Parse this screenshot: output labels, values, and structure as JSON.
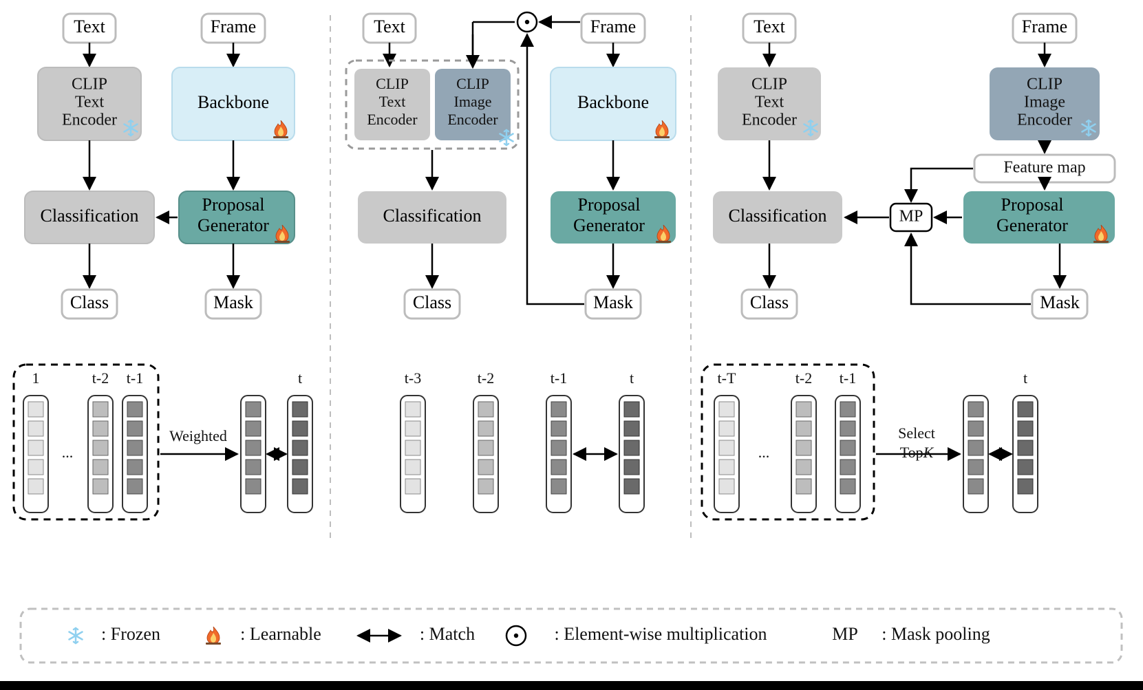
{
  "labels": {
    "text": "Text",
    "frame": "Frame",
    "clipText1": "CLIP",
    "clipText2": "Text",
    "clipText3": "Encoder",
    "clipImg1": "CLIP",
    "clipImg2": "Image",
    "clipImg3": "Encoder",
    "backbone": "Backbone",
    "classification": "Classification",
    "proposal1": "Proposal",
    "proposal2": "Generator",
    "class": "Class",
    "mask": "Mask",
    "featureMap": "Feature map",
    "mp": "MP",
    "weighted": "Weighted",
    "select": "Select",
    "topk": "TopK",
    "times_1": "1",
    "times_dots": "...",
    "times_t2": "t-2",
    "times_t1": "t-1",
    "times_t": "t",
    "times_t3": "t-3",
    "times_tT": "t-T"
  },
  "legend": {
    "frozen": ": Frozen",
    "learnable": ": Learnable",
    "match": ": Match",
    "elemwise": ": Element-wise multiplication",
    "maskpool": ": Mask pooling",
    "mp": "MP"
  },
  "colors": {
    "gray": "#c9c9c9",
    "lightblue": "#d8eef7",
    "teal": "#6aa9a3",
    "slate": "#93a6b5",
    "outline": "#bcbcbc"
  }
}
